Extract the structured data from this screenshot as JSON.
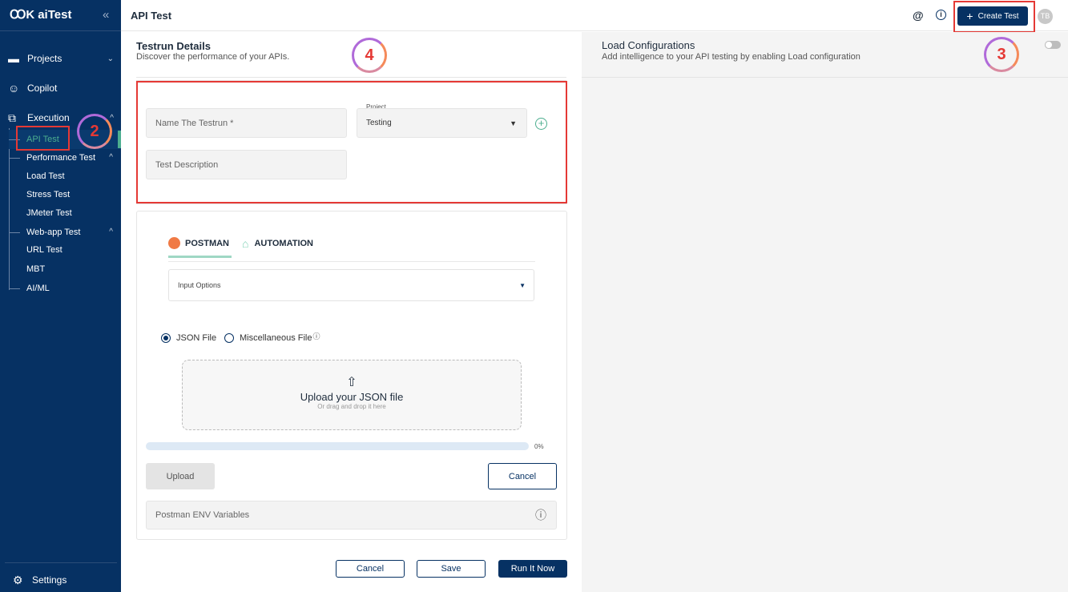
{
  "app": {
    "logo": "aiTest",
    "collapse_icon": "double-chevron-left"
  },
  "sidebar": {
    "items": [
      {
        "label": "Projects",
        "icon": "folder-icon"
      },
      {
        "label": "Copilot",
        "icon": "copilot-icon"
      },
      {
        "label": "Execution",
        "icon": "external-edit-icon"
      }
    ],
    "sub_items": [
      "API Test",
      "Performance Test",
      "Load Test",
      "Stress Test",
      "JMeter Test",
      "Web-app Test",
      "URL Test",
      "MBT",
      "AI/ML"
    ],
    "settings": "Settings"
  },
  "header": {
    "title": "API Test",
    "create_label": "Create Test",
    "avatar": "TB"
  },
  "testrun": {
    "title": "Testrun Details",
    "subtitle": "Discover the performance of your APIs.",
    "name_placeholder": "Name The Testrun *",
    "project_label": "Project",
    "project_value": "Testing",
    "description_placeholder": "Test Description"
  },
  "tabs": [
    {
      "label": "POSTMAN",
      "active": true
    },
    {
      "label": "AUTOMATION",
      "active": false
    }
  ],
  "input_options": "Input Options",
  "radios": [
    {
      "label": "JSON File",
      "checked": true
    },
    {
      "label": "Miscellaneous File",
      "checked": false
    }
  ],
  "upload": {
    "title": "Upload your JSON file",
    "hint": "Or drag and drop it here",
    "progress_text": "0%",
    "progress": 0,
    "upload_label": "Upload",
    "cancel_label": "Cancel"
  },
  "env_label": "Postman ENV Variables",
  "footer": {
    "cancel": "Cancel",
    "save": "Save",
    "run": "Run It Now"
  },
  "load": {
    "title": "Load Configurations",
    "subtitle": "Add intelligence to your API testing by enabling Load configuration",
    "enabled": false
  },
  "annotations": [
    "2",
    "3",
    "4"
  ],
  "colors": {
    "sidebar": "#063163",
    "accent": "#4cae8f",
    "annotation": "#e53935"
  }
}
